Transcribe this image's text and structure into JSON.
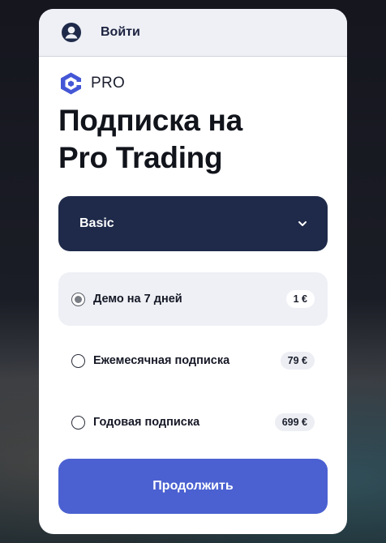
{
  "header": {
    "login_label": "Войти"
  },
  "logo": {
    "text": "PRO"
  },
  "title": {
    "line1": "Подписка на",
    "line2": "Pro Trading"
  },
  "plan_select": {
    "value": "Basic"
  },
  "options": [
    {
      "label": "Демо на 7 дней",
      "price": "1 €",
      "selected": true
    },
    {
      "label": "Ежемесячная подписка",
      "price": "79 €",
      "selected": false
    },
    {
      "label": "Годовая подписка",
      "price": "699 €",
      "selected": false
    }
  ],
  "continue_label": "Продолжить",
  "colors": {
    "accent": "#4b61d1",
    "select_bg": "#1f2a4a",
    "logo_blue": "#4457d6"
  }
}
